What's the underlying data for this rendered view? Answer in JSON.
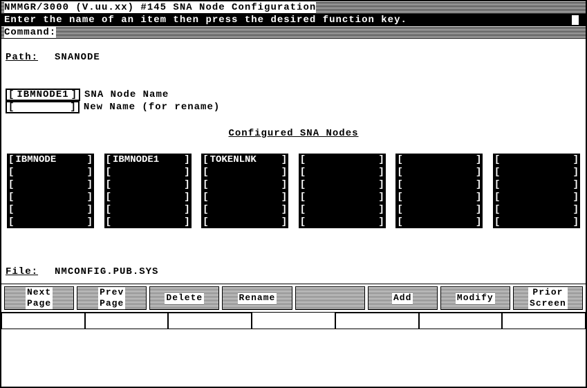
{
  "header": {
    "title": "NMMGR/3000 (V.uu.xx) #145  SNA Node Configuration",
    "prompt": "Enter the name of an item then press the desired function key.",
    "command_label": "Command:"
  },
  "path": {
    "label": "Path:",
    "value": "SNANODE"
  },
  "fields": {
    "node_name": {
      "box_value": "IBMNODE1",
      "label": "SNA Node Name"
    },
    "new_name": {
      "box_value": "",
      "label": "New Name (for rename)"
    }
  },
  "section_title": "Configured SNA Nodes",
  "columns": [
    [
      "IBMNODE",
      "",
      "",
      "",
      "",
      ""
    ],
    [
      "IBMNODE1",
      "",
      "",
      "",
      "",
      ""
    ],
    [
      "TOKENLNK",
      "",
      "",
      "",
      "",
      ""
    ],
    [
      "",
      "",
      "",
      "",
      "",
      ""
    ],
    [
      "",
      "",
      "",
      "",
      "",
      ""
    ],
    [
      "",
      "",
      "",
      "",
      "",
      ""
    ]
  ],
  "file": {
    "label": "File:",
    "value": "NMCONFIG.PUB.SYS"
  },
  "fn_keys": [
    "Next\nPage",
    "Prev\nPage",
    "Delete",
    "Rename",
    "",
    "Add",
    "Modify",
    "Prior\nScreen"
  ]
}
